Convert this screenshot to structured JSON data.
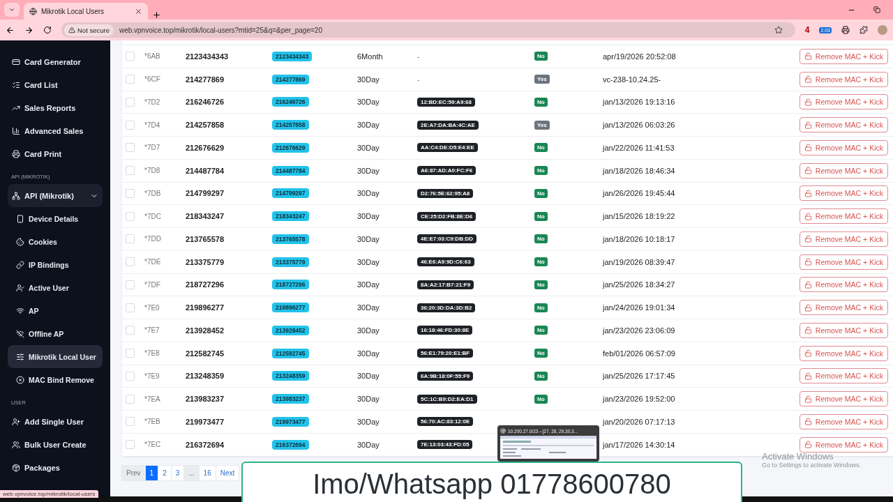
{
  "browser": {
    "tab_title": "Mikrotik Local Users",
    "security": "Not secure",
    "url": "web.vpnvoice.top/mikrotik/local-users?mtid=25&q=&per_page=20",
    "extension_count": "4",
    "extension_badge": "2.03"
  },
  "sidebar": {
    "sections": [
      {
        "items": [
          {
            "label": "Card Generator",
            "selected": false
          },
          {
            "label": "Card List",
            "selected": false
          },
          {
            "label": "Sales Reports",
            "selected": false
          },
          {
            "label": "Advanced Sales",
            "selected": false
          },
          {
            "label": "Card Print",
            "selected": false
          }
        ]
      },
      {
        "label": "API (MIKROTIK)",
        "items": [
          {
            "label": "API (Mikrotik)",
            "selected": false,
            "expanded": true,
            "children": [
              {
                "label": "Device Details",
                "selected": false
              },
              {
                "label": "Cookies",
                "selected": false
              },
              {
                "label": "IP Bindings",
                "selected": false
              },
              {
                "label": "Active User",
                "selected": false
              },
              {
                "label": "AP",
                "selected": false
              },
              {
                "label": "Offline AP",
                "selected": false
              },
              {
                "label": "Mikrotik Local User",
                "selected": true
              },
              {
                "label": "MAC Bind Remove",
                "selected": false
              }
            ]
          }
        ]
      },
      {
        "label": "USER",
        "items": [
          {
            "label": "Add Single User",
            "selected": false
          },
          {
            "label": "Bulk User Create",
            "selected": false
          },
          {
            "label": "Packages",
            "selected": false
          }
        ]
      }
    ]
  },
  "table": {
    "rows": [
      {
        "checked": false,
        "id": "*6AB",
        "username": "2123434343",
        "password": "2123434343",
        "profile": "6Month",
        "mac": {
          "text": "-",
          "kind": "plain"
        },
        "bypass": {
          "label": "No",
          "color": "#198754"
        },
        "last_seen": "apr/19/2026 20:52:08",
        "action": "Remove MAC + Kick"
      },
      {
        "checked": false,
        "id": "*6CF",
        "username": "214277869",
        "password": "214277869",
        "profile": "30Day",
        "mac": {
          "text": "-",
          "kind": "plain"
        },
        "bypass": {
          "label": "Yes",
          "color": "#6c757d"
        },
        "last_seen": "vc-238-10.24.25-",
        "action": "Remove MAC + Kick"
      },
      {
        "checked": false,
        "id": "*7D2",
        "username": "216246726",
        "password": "216246726",
        "profile": "30Day",
        "mac": {
          "text": "12:BD:EC:59:A9:68",
          "kind": "badge"
        },
        "bypass": {
          "label": "No",
          "color": "#198754"
        },
        "last_seen": "jan/13/2026 19:13:16",
        "action": "Remove MAC + Kick"
      },
      {
        "checked": false,
        "id": "*7D4",
        "username": "214257858",
        "password": "214257858",
        "profile": "30Day",
        "mac": {
          "text": "2E:A7:DA:BA:4C:AE",
          "kind": "badge"
        },
        "bypass": {
          "label": "Yes",
          "color": "#6c757d"
        },
        "last_seen": "jan/13/2026 06:03:26",
        "action": "Remove MAC + Kick"
      },
      {
        "checked": false,
        "id": "*7D7",
        "username": "212676629",
        "password": "212676629",
        "profile": "30Day",
        "mac": {
          "text": "AA:C4:DE:D5:E4:EE",
          "kind": "badge"
        },
        "bypass": {
          "label": "No",
          "color": "#198754"
        },
        "last_seen": "jan/22/2026 11:41:53",
        "action": "Remove MAC + Kick"
      },
      {
        "checked": false,
        "id": "*7D8",
        "username": "214487784",
        "password": "214487784",
        "profile": "30Day",
        "mac": {
          "text": "A6:87:AD:A0:FC:F6",
          "kind": "badge"
        },
        "bypass": {
          "label": "No",
          "color": "#198754"
        },
        "last_seen": "jan/18/2026 18:46:34",
        "action": "Remove MAC + Kick"
      },
      {
        "checked": false,
        "id": "*7DB",
        "username": "214799297",
        "password": "214799297",
        "profile": "30Day",
        "mac": {
          "text": "D2:76:5E:62:95:A8",
          "kind": "badge"
        },
        "bypass": {
          "label": "No",
          "color": "#198754"
        },
        "last_seen": "jan/26/2026 19:45:44",
        "action": "Remove MAC + Kick"
      },
      {
        "checked": false,
        "id": "*7DC",
        "username": "218343247",
        "password": "218343247",
        "profile": "30Day",
        "mac": {
          "text": "CE:25:D2:FB:8E:D6",
          "kind": "badge"
        },
        "bypass": {
          "label": "No",
          "color": "#198754"
        },
        "last_seen": "jan/15/2026 18:19:22",
        "action": "Remove MAC + Kick"
      },
      {
        "checked": false,
        "id": "*7DD",
        "username": "213765578",
        "password": "213765578",
        "profile": "30Day",
        "mac": {
          "text": "4E:E7:03:C9:DB:DD",
          "kind": "badge"
        },
        "bypass": {
          "label": "No",
          "color": "#198754"
        },
        "last_seen": "jan/18/2026 10:18:17",
        "action": "Remove MAC + Kick"
      },
      {
        "checked": false,
        "id": "*7DE",
        "username": "213375779",
        "password": "213375779",
        "profile": "30Day",
        "mac": {
          "text": "46:E6:A9:9D:C6:63",
          "kind": "badge"
        },
        "bypass": {
          "label": "No",
          "color": "#198754"
        },
        "last_seen": "jan/19/2026 08:39:47",
        "action": "Remove MAC + Kick"
      },
      {
        "checked": false,
        "id": "*7DF",
        "username": "218727296",
        "password": "218727296",
        "profile": "30Day",
        "mac": {
          "text": "8A:A2:17:B7:21:F9",
          "kind": "badge"
        },
        "bypass": {
          "label": "No",
          "color": "#198754"
        },
        "last_seen": "jan/25/2026 18:34:27",
        "action": "Remove MAC + Kick"
      },
      {
        "checked": false,
        "id": "*7E0",
        "username": "219896277",
        "password": "219896277",
        "profile": "30Day",
        "mac": {
          "text": "36:20:3D:DA:3D:B2",
          "kind": "badge"
        },
        "bypass": {
          "label": "No",
          "color": "#198754"
        },
        "last_seen": "jan/24/2026 19:01:34",
        "action": "Remove MAC + Kick"
      },
      {
        "checked": false,
        "id": "*7E7",
        "username": "213928452",
        "password": "213928452",
        "profile": "30Day",
        "mac": {
          "text": "16:18:46:FD:30:8E",
          "kind": "badge"
        },
        "bypass": {
          "label": "No",
          "color": "#198754"
        },
        "last_seen": "jan/23/2026 23:06:09",
        "action": "Remove MAC + Kick"
      },
      {
        "checked": false,
        "id": "*7E8",
        "username": "212582745",
        "password": "212582745",
        "profile": "30Day",
        "mac": {
          "text": "56:E1:79:20:E1:BF",
          "kind": "badge"
        },
        "bypass": {
          "label": "No",
          "color": "#198754"
        },
        "last_seen": "feb/01/2026 06:57:09",
        "action": "Remove MAC + Kick"
      },
      {
        "checked": false,
        "id": "*7E9",
        "username": "213248359",
        "password": "213248359",
        "profile": "30Day",
        "mac": {
          "text": "6A:9B:18:0F:55:F9",
          "kind": "badge"
        },
        "bypass": {
          "label": "No",
          "color": "#198754"
        },
        "last_seen": "jan/25/2026 17:17:45",
        "action": "Remove MAC + Kick"
      },
      {
        "checked": false,
        "id": "*7EA",
        "username": "213983237",
        "password": "213983237",
        "profile": "30Day",
        "mac": {
          "text": "5C:1C:B9:D2:EA:D1",
          "kind": "badge"
        },
        "bypass": {
          "label": "No",
          "color": "#198754"
        },
        "last_seen": "jan/23/2026 19:52:00",
        "action": "Remove MAC + Kick"
      },
      {
        "checked": false,
        "id": "*7EB",
        "username": "219973477",
        "password": "219973477",
        "profile": "30Day",
        "mac": {
          "text": "56:70:AC:83:12:0E",
          "kind": "badge"
        },
        "last_seen": "jan/20/2026 07:17:13",
        "action": "Remove MAC + Kick"
      },
      {
        "checked": false,
        "id": "*7EC",
        "username": "216372694",
        "password": "216372694",
        "profile": "30Day",
        "mac": {
          "text": "7E:13:03:43:FD:05",
          "kind": "badge"
        },
        "last_seen": "jan/17/2026 14:30:14",
        "action": "Remove MAC + Kick"
      }
    ]
  },
  "pagination": [
    {
      "label": "Prev",
      "kind": "nav",
      "selected": false
    },
    {
      "label": "1",
      "kind": "page",
      "selected": true
    },
    {
      "label": "2",
      "kind": "page",
      "selected": false
    },
    {
      "label": "3",
      "kind": "page",
      "selected": false
    },
    {
      "label": "...",
      "kind": "gap",
      "selected": false
    },
    {
      "label": "16",
      "kind": "page",
      "selected": false
    },
    {
      "label": "Next",
      "kind": "nav",
      "selected": false
    }
  ],
  "status_url": "web.vpnvoice.top/mikrotik/local-users",
  "taskbar_preview": {
    "title": "10.200.27.0/23 --[27, 28, 29,30,3..."
  },
  "banner": "Imo/Whatsapp 01778600780",
  "os_notice": {
    "title": "Activate Windows",
    "subtitle": "Go to Settings to activate Windows."
  }
}
